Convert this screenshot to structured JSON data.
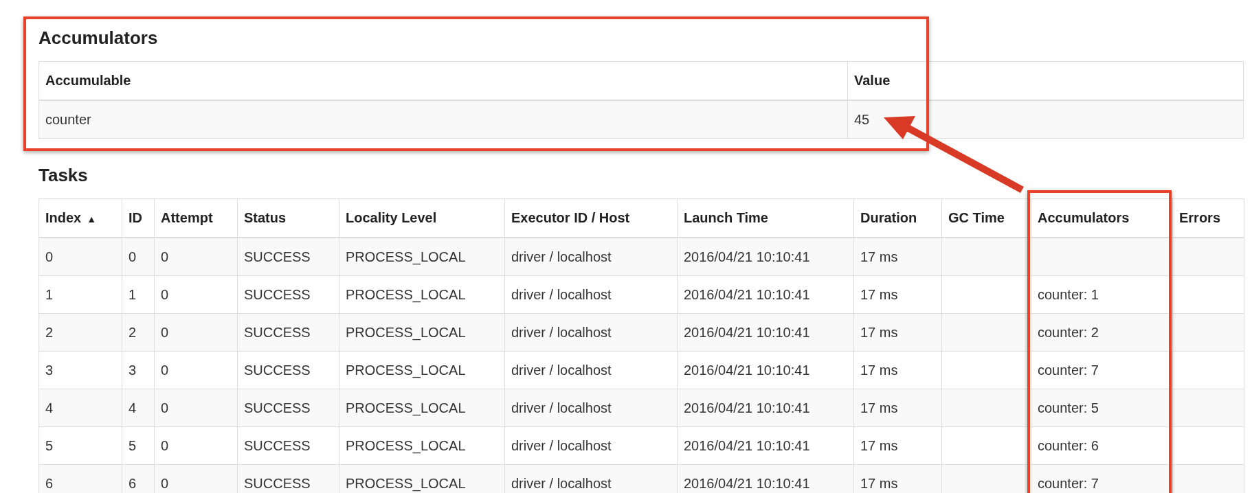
{
  "accumulators": {
    "title": "Accumulators",
    "columns": [
      "Accumulable",
      "Value"
    ],
    "rows": [
      {
        "name": "counter",
        "value": "45"
      }
    ]
  },
  "tasks": {
    "title": "Tasks",
    "columns": [
      {
        "label": "Index",
        "sort_indicator": "▲"
      },
      {
        "label": "ID"
      },
      {
        "label": "Attempt"
      },
      {
        "label": "Status"
      },
      {
        "label": "Locality Level"
      },
      {
        "label": "Executor ID / Host"
      },
      {
        "label": "Launch Time"
      },
      {
        "label": "Duration"
      },
      {
        "label": "GC Time"
      },
      {
        "label": "Accumulators"
      },
      {
        "label": "Errors"
      }
    ],
    "rows": [
      {
        "index": "0",
        "id": "0",
        "attempt": "0",
        "status": "SUCCESS",
        "locality": "PROCESS_LOCAL",
        "executor": "driver / localhost",
        "launch_time": "2016/04/21 10:10:41",
        "duration": "17 ms"
      },
      {
        "index": "1",
        "id": "1",
        "attempt": "0",
        "status": "SUCCESS",
        "locality": "PROCESS_LOCAL",
        "executor": "driver / localhost",
        "launch_time": "2016/04/21 10:10:41",
        "duration": "17 ms",
        "accumulators": "counter: 1"
      },
      {
        "index": "2",
        "id": "2",
        "attempt": "0",
        "status": "SUCCESS",
        "locality": "PROCESS_LOCAL",
        "executor": "driver / localhost",
        "launch_time": "2016/04/21 10:10:41",
        "duration": "17 ms",
        "accumulators": "counter: 2"
      },
      {
        "index": "3",
        "id": "3",
        "attempt": "0",
        "status": "SUCCESS",
        "locality": "PROCESS_LOCAL",
        "executor": "driver / localhost",
        "launch_time": "2016/04/21 10:10:41",
        "duration": "17 ms",
        "accumulators": "counter: 7"
      },
      {
        "index": "4",
        "id": "4",
        "attempt": "0",
        "status": "SUCCESS",
        "locality": "PROCESS_LOCAL",
        "executor": "driver / localhost",
        "launch_time": "2016/04/21 10:10:41",
        "duration": "17 ms",
        "accumulators": "counter: 5"
      },
      {
        "index": "5",
        "id": "5",
        "attempt": "0",
        "status": "SUCCESS",
        "locality": "PROCESS_LOCAL",
        "executor": "driver / localhost",
        "launch_time": "2016/04/21 10:10:41",
        "duration": "17 ms",
        "accumulators": "counter: 6"
      },
      {
        "index": "6",
        "id": "6",
        "attempt": "0",
        "status": "SUCCESS",
        "locality": "PROCESS_LOCAL",
        "executor": "driver / localhost",
        "launch_time": "2016/04/21 10:10:41",
        "duration": "17 ms",
        "accumulators": "counter: 7"
      }
    ]
  }
}
